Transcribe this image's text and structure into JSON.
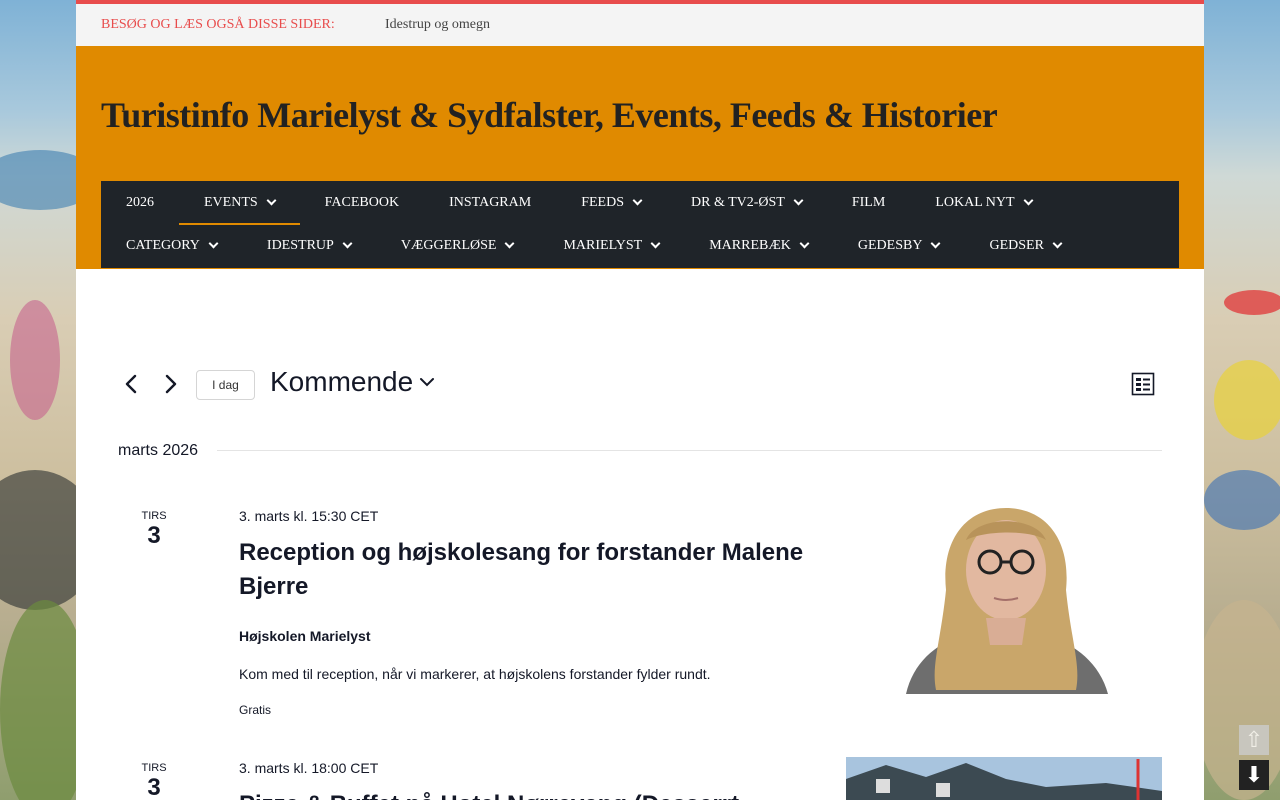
{
  "topbar": {
    "label": "BESØG OG LÆS OGSÅ DISSE SIDER:",
    "link": "Idestrup og omegn"
  },
  "header": {
    "title": "Turistinfo Marielyst & Sydfalster, Events, Feeds & Historier"
  },
  "nav": {
    "row1": [
      {
        "label": "2026",
        "dropdown": false
      },
      {
        "label": "EVENTS",
        "dropdown": true,
        "active": true
      },
      {
        "label": "FACEBOOK",
        "dropdown": false
      },
      {
        "label": "INSTAGRAM",
        "dropdown": false
      },
      {
        "label": "FEEDS",
        "dropdown": true
      },
      {
        "label": "DR & TV2-ØST",
        "dropdown": true
      },
      {
        "label": "FILM",
        "dropdown": false
      },
      {
        "label": "LOKAL NYT",
        "dropdown": true
      }
    ],
    "row2": [
      {
        "label": "CATEGORY",
        "dropdown": true
      },
      {
        "label": "IDESTRUP",
        "dropdown": true
      },
      {
        "label": "VÆGGERLØSE",
        "dropdown": true
      },
      {
        "label": "MARIELYST",
        "dropdown": true
      },
      {
        "label": "MARREBÆK",
        "dropdown": true
      },
      {
        "label": "GEDESBY",
        "dropdown": true
      },
      {
        "label": "GEDSER",
        "dropdown": true
      }
    ]
  },
  "toolbar": {
    "today_label": "I dag",
    "view_label": "Kommende"
  },
  "month": {
    "label": "marts 2026"
  },
  "events": [
    {
      "dow": "TIRS",
      "day": "3",
      "time": "3. marts kl. 15:30 CET",
      "title": "Reception og højskolesang for forstander Malene Bjerre",
      "venue": "Højskolen Marielyst",
      "description": "Kom med til reception, når vi markerer, at højskolens forstander fylder rundt.",
      "cost": "Gratis"
    },
    {
      "dow": "TIRS",
      "day": "3",
      "time": "3. marts kl. 18:00 CET",
      "title": "Pizza & Buffet på Hotel Nørrevang (Desserrt",
      "venue": "",
      "description": "",
      "cost": ""
    }
  ],
  "colors": {
    "accent_red": "#e84c4c",
    "header_orange": "#e08a00",
    "nav_dark": "#1f2429"
  }
}
